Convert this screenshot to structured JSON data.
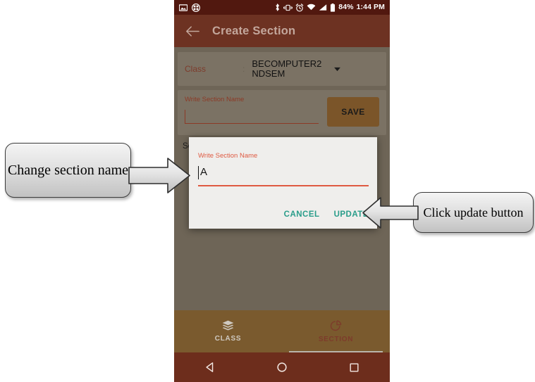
{
  "status_bar": {
    "icons_left": [
      "image-icon",
      "app-grid-icon"
    ],
    "icons_right": [
      "bluetooth-icon",
      "vibrate-icon",
      "alarm-icon",
      "wifi-icon",
      "signal-icon",
      "battery-icon"
    ],
    "battery_percent": "84%",
    "clock": "1:44 PM"
  },
  "app_bar": {
    "back_icon": "back-arrow-icon",
    "title": "Create Section"
  },
  "form": {
    "class_label": "Class",
    "class_separator": ":",
    "class_value": "BECOMPUTER2 NDSEM",
    "class_dropdown_icon": "chevron-down-icon",
    "section_name_label": "Write Section Name",
    "section_name_value": "",
    "save_label": "SAVE",
    "section_list_label": "Section List"
  },
  "dialog": {
    "label": "Write Section Name",
    "value": "A",
    "cancel_label": "CANCEL",
    "update_label": "UPDATE"
  },
  "tabs": [
    {
      "label": "CLASS",
      "icon": "layers-icon",
      "selected": false
    },
    {
      "label": "SECTION",
      "icon": "pie-chart-icon",
      "selected": true
    }
  ],
  "nav_bar": {
    "back": "nav-back-icon",
    "home": "nav-home-icon",
    "recents": "nav-recents-icon"
  },
  "annotations": [
    {
      "text": "Change section name",
      "arrow": "arrow-right-pointing"
    },
    {
      "text": "Click update button",
      "arrow": "arrow-left-pointing"
    }
  ],
  "colors": {
    "status_bar": "#51180f",
    "app_bar": "#6d3222",
    "accent_orange": "#df5a42",
    "teal_action": "#2a9d8a",
    "tab_bar": "#7a5a2e",
    "nav_bar": "#6d2d1c",
    "scrim": "#6e6557"
  }
}
